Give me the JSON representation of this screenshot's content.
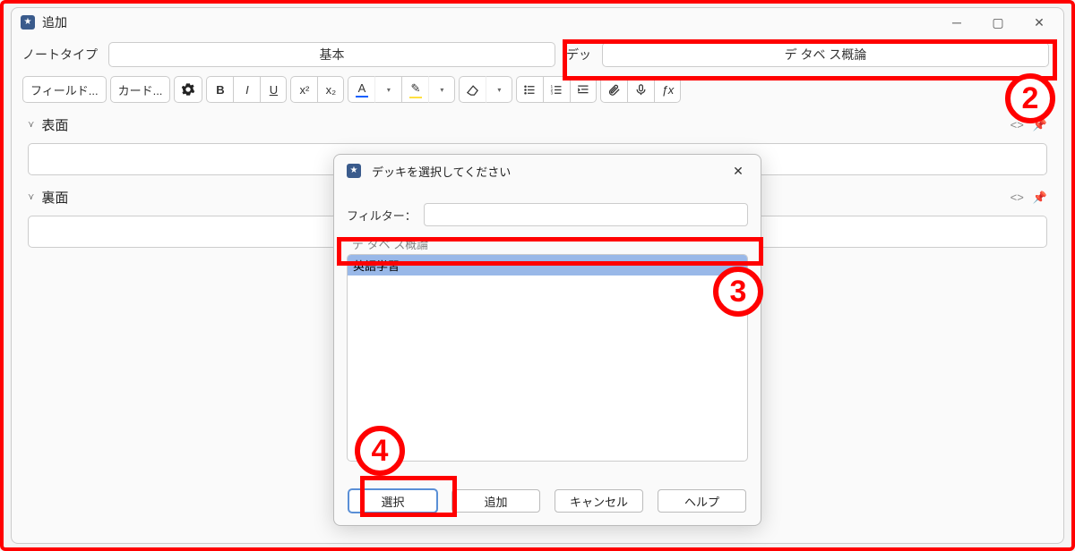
{
  "window": {
    "title": "追加"
  },
  "row1": {
    "notetype_label": "ノートタイプ",
    "notetype_value": "基本",
    "deck_label": "デッ",
    "deck_value": "デ   タベ  ス概論"
  },
  "toolbar": {
    "fields": "フィールド...",
    "cards": "カード...",
    "bold": "B",
    "italic": "I",
    "underline": "U",
    "super": "x²",
    "sub": "x₂",
    "textcolor": "A",
    "highlight": "✎",
    "fx": "ƒx"
  },
  "fields": {
    "front": "表面",
    "back": "裏面"
  },
  "dialog": {
    "title": "デッキを選択してください",
    "filter_label": "フィルター：",
    "item_hidden": "デ  タベ  ス概論",
    "item0": "英語学習",
    "buttons": {
      "select": "選択",
      "add": "追加",
      "cancel": "キャンセル",
      "help": "ヘルプ"
    }
  },
  "annotations": {
    "b2": "2",
    "b3": "3",
    "b4": "4"
  }
}
